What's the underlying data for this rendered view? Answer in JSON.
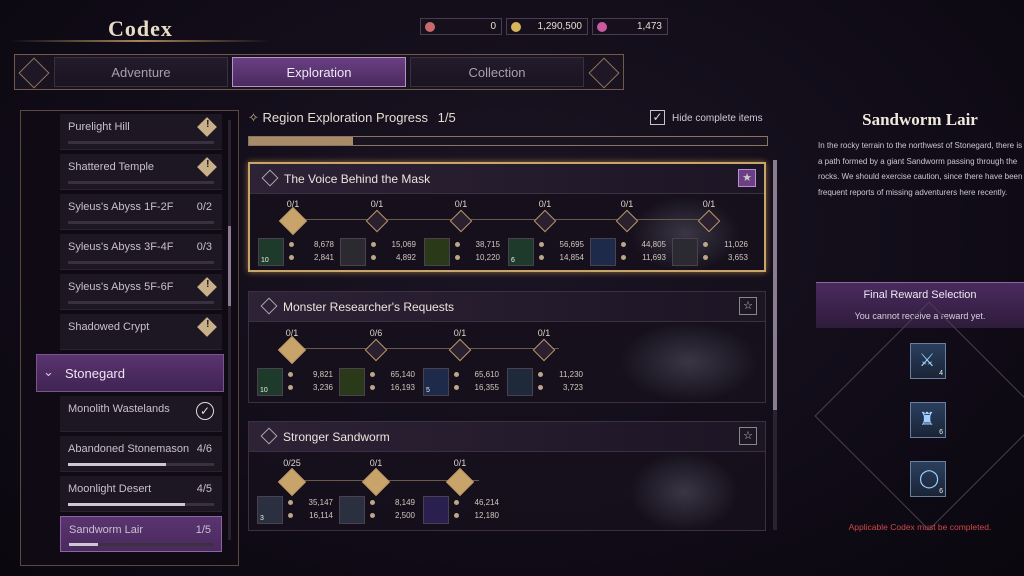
{
  "header": {
    "title": "Codex"
  },
  "currencies": [
    {
      "icon": "ticket-icon",
      "value": "0"
    },
    {
      "icon": "gold-coin-icon",
      "value": "1,290,500"
    },
    {
      "icon": "gem-icon",
      "value": "1,473"
    }
  ],
  "tabs": [
    {
      "label": "Adventure",
      "active": false
    },
    {
      "label": "Exploration",
      "active": true
    },
    {
      "label": "Collection",
      "active": false
    }
  ],
  "region_list": {
    "items": [
      {
        "label": "Purelight Hill",
        "status": "warning"
      },
      {
        "label": "Shattered Temple",
        "status": "warning"
      },
      {
        "label": "Syleus's Abyss 1F-2F",
        "count": "0/2",
        "progress": 0
      },
      {
        "label": "Syleus's Abyss 3F-4F",
        "count": "0/3",
        "progress": 0
      },
      {
        "label": "Syleus's Abyss 5F-6F",
        "status": "warning"
      },
      {
        "label": "Shadowed Crypt",
        "status": "warning"
      }
    ],
    "group": {
      "label": "Stonegard",
      "expanded": true
    },
    "group_items": [
      {
        "label": "Monolith Wastelands",
        "status": "complete"
      },
      {
        "label": "Abandoned Stonemason",
        "count": "4/6",
        "progress": 0.67
      },
      {
        "label": "Moonlight Desert",
        "count": "4/5",
        "progress": 0.8
      },
      {
        "label": "Sandworm Lair",
        "count": "1/5",
        "progress": 0.2,
        "selected": true
      }
    ]
  },
  "progress": {
    "label": "Region Exploration Progress",
    "value": "1/5",
    "fraction": 0.2
  },
  "hide_complete": {
    "label": "Hide complete items",
    "checked": true
  },
  "quests": [
    {
      "title": "The Voice Behind the Mask",
      "starred": true,
      "stages": [
        "0/1",
        "0/1",
        "0/1",
        "0/1",
        "0/1",
        "0/1"
      ],
      "rewards": [
        {
          "qty": "10",
          "v1": "8,678",
          "v2": "2,841"
        },
        {
          "qty": "",
          "v1": "15,069",
          "v2": "4,892"
        },
        {
          "qty": "",
          "v1": "38,715",
          "v2": "10,220"
        },
        {
          "qty": "6",
          "v1": "56,695",
          "v2": "14,854"
        },
        {
          "qty": "",
          "v1": "44,805",
          "v2": "11,693"
        },
        {
          "qty": "",
          "v1": "11,026",
          "v2": "3,653"
        }
      ]
    },
    {
      "title": "Monster Researcher's Requests",
      "starred": false,
      "stages": [
        "0/1",
        "0/6",
        "0/1",
        "0/1"
      ],
      "rewards": [
        {
          "qty": "10",
          "v1": "9,821",
          "v2": "3,236"
        },
        {
          "qty": "",
          "v1": "65,140",
          "v2": "16,193"
        },
        {
          "qty": "5",
          "v1": "65,610",
          "v2": "16,355"
        },
        {
          "qty": "",
          "v1": "11,230",
          "v2": "3,723"
        }
      ]
    },
    {
      "title": "Stronger Sandworm",
      "starred": false,
      "stages": [
        "0/25",
        "0/1",
        "0/1"
      ],
      "rewards": [
        {
          "qty": "3",
          "v1": "35,147",
          "v2": "16,114"
        },
        {
          "qty": "",
          "v1": "8,149",
          "v2": "2,500"
        },
        {
          "qty": "",
          "v1": "46,214",
          "v2": "12,180"
        }
      ]
    }
  ],
  "detail": {
    "title": "Sandworm Lair",
    "description": "In the rocky terrain to the northwest of Stonegard, there is a path formed by a giant Sandworm passing through the rocks. We should exercise caution, since there have been frequent reports of missing adventurers here recently.",
    "final_reward_title": "Final Reward Selection",
    "final_reward_sub": "You cannot receive a reward yet.",
    "final_rewards": [
      {
        "icon": "crossed-swords-icon",
        "qty": "4"
      },
      {
        "icon": "armor-icon",
        "qty": "6"
      },
      {
        "icon": "ring-icon",
        "qty": "6"
      }
    ],
    "warning": "Applicable Codex must be completed."
  }
}
